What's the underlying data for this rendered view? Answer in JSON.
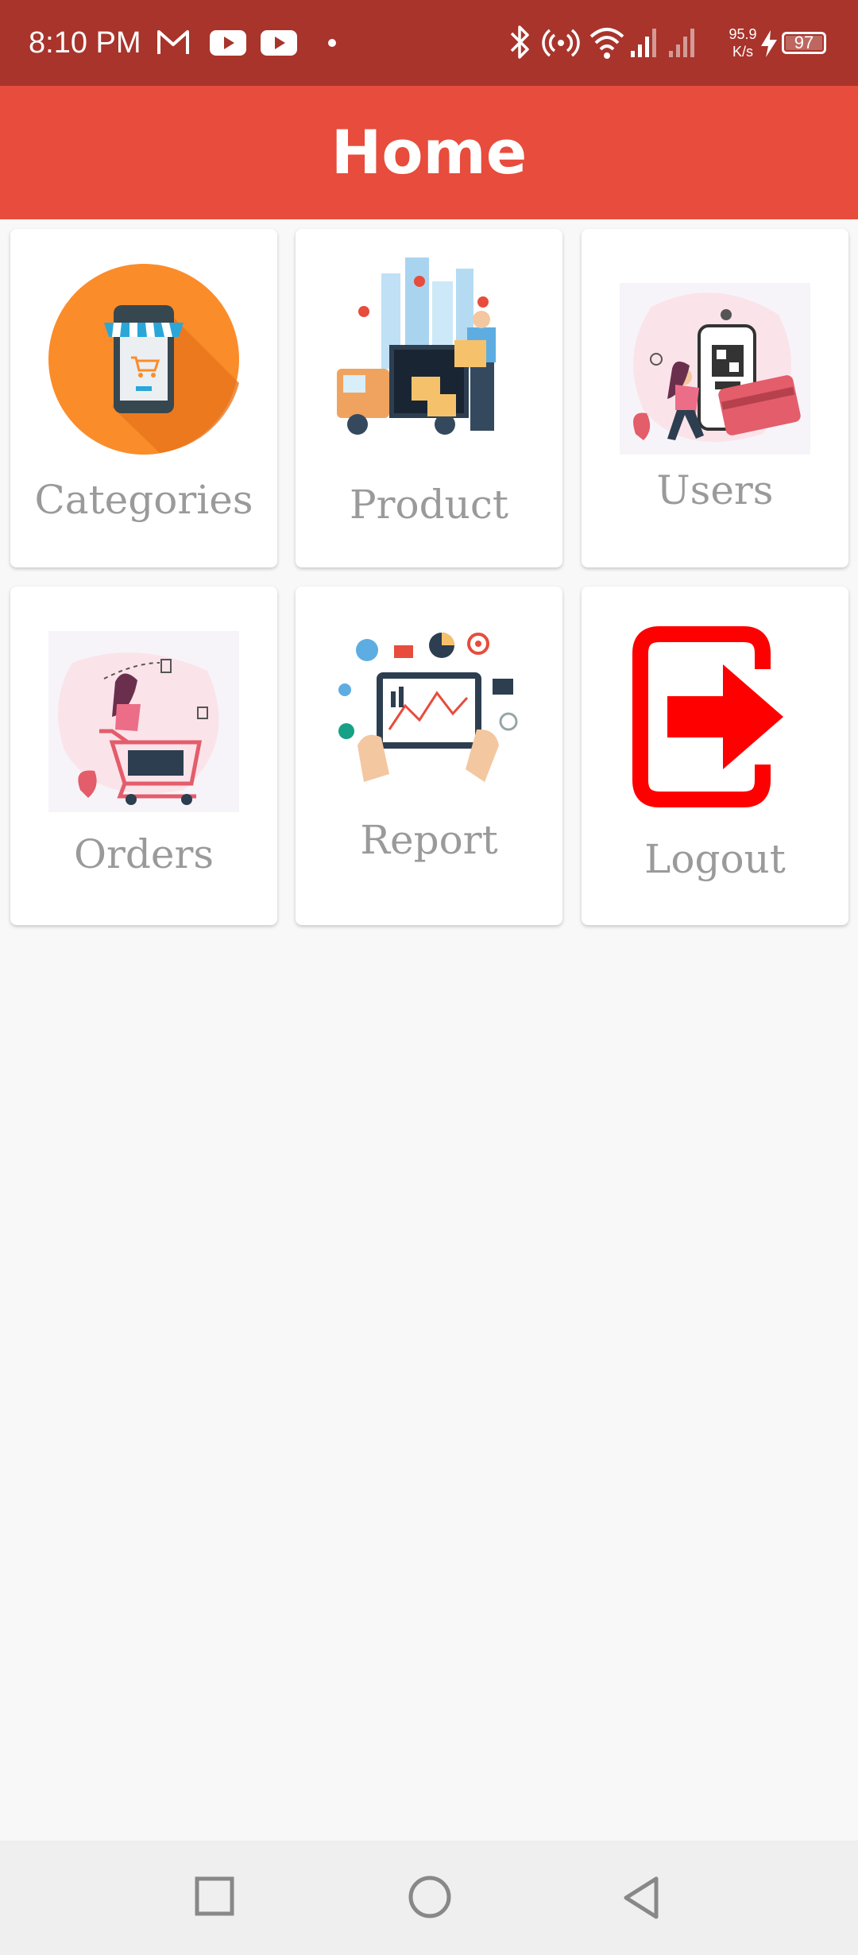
{
  "status_bar": {
    "time": "8:10 PM",
    "speed_value": "95.9",
    "speed_unit": "K/s",
    "battery": "97",
    "icons": [
      "gmail-icon",
      "youtube-icon",
      "youtube-icon",
      "dot-icon",
      "bluetooth-icon",
      "hotspot-icon",
      "wifi-icon",
      "signal-icon",
      "signal-icon",
      "charging-icon"
    ]
  },
  "app_bar": {
    "title": "Home"
  },
  "cards": [
    {
      "label": "Categories",
      "icon": "store-phone-icon"
    },
    {
      "label": "Product",
      "icon": "delivery-truck-icon"
    },
    {
      "label": "Users",
      "icon": "mobile-payment-icon"
    },
    {
      "label": "Orders",
      "icon": "shopping-cart-icon"
    },
    {
      "label": "Report",
      "icon": "analytics-tablet-icon"
    },
    {
      "label": "Logout",
      "icon": "logout-icon"
    }
  ],
  "colors": {
    "status_bar": "#a8342b",
    "app_bar": "#e74c3c",
    "logout_red": "#ff0000",
    "label_gray": "#9a9a9a"
  },
  "nav_bar": {
    "buttons": [
      "recents-button",
      "home-button",
      "back-button"
    ]
  }
}
